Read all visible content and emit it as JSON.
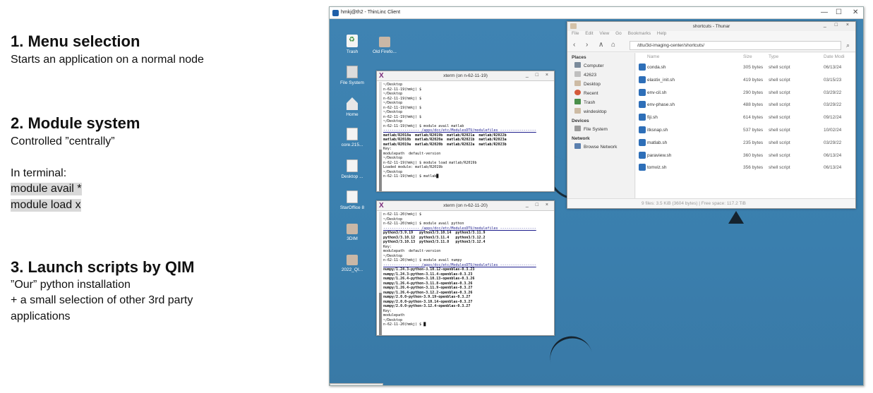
{
  "slide": {
    "s1_title": "1. Menu selection",
    "s1_line1": "Starts an application on a normal node",
    "s2_title": "2. Module system",
    "s2_line1": "Controlled ”centrally”",
    "s2_line2": "In terminal:",
    "s2_cmd1": "module avail *",
    "s2_cmd2": "module load x",
    "s3_title": "3. Launch scripts by QIM",
    "s3_line1": "”Our” python installation",
    "s3_line2": "+ a small selection of other 3rd party",
    "s3_line3": "applications"
  },
  "window": {
    "title": "hmkj@th2 - ThinLinc Client",
    "ctrl_min": "—",
    "ctrl_max": "☐",
    "ctrl_close": "✕"
  },
  "desktop_icons": [
    {
      "label": "Trash",
      "icon": "trash-icon"
    },
    {
      "label": "Old Firefo...",
      "icon": "folder-icon"
    },
    {
      "label": "File System",
      "icon": "filesystem-icon"
    },
    {
      "label": "Home",
      "icon": "home-icon"
    },
    {
      "label": "core.215...",
      "icon": "file-icon"
    },
    {
      "label": "Desktop ...",
      "icon": "file-icon"
    },
    {
      "label": "StarOffice 8",
      "icon": "file-icon"
    },
    {
      "label": "3DIM",
      "icon": "folder-icon"
    },
    {
      "label": "2022_QI...",
      "icon": "folder-icon"
    }
  ],
  "xterm1": {
    "title": "xterm (on n-62-11-19)",
    "controls": "_ □ ×",
    "lines": [
      "~/Desktop",
      "n-62-11-19(hmkj) $",
      "~/Desktop",
      "n-62-11-19(hmkj) $",
      "~/Desktop",
      "n-62-11-19(hmkj) $",
      "~/Desktop",
      "n-62-11-19(hmkj) $",
      "~/Desktop",
      "n-62-11-19(hmkj) $ module avail matlab",
      "----------------- /apps/dcc/etc/ModulesDTU/modulefiles -----------------",
      "matlab/R2018a  matlab/R2019b  matlab/R2021a  matlab/R2022b",
      "matlab/R2018b  matlab/R2020a  matlab/R2021b  matlab/R2023a",
      "matlab/R2019a  matlab/R2020b  matlab/R2022a  matlab/R2023b",
      "",
      "Key:",
      "modulepath  default-version",
      "~/Desktop",
      "n-62-11-19(hmkj) $ module load matlab/R2019b",
      "Loaded module: matlab/R2019b",
      "~/Desktop",
      "n-62-11-19(hmkj) $ matlab█"
    ]
  },
  "xterm2": {
    "title": "xterm (on n-62-11-20)",
    "controls": "_ □ ×",
    "lines": [
      "n-62-11-20(hmkj) $",
      "~/Desktop",
      "n-62-11-20(hmkj) $ module avail python",
      "----------------- /apps/dcc/etc/ModulesDTU/modulefiles -----------------",
      "python3/3.9.19   python3/3.10.14  python3/3.11.9",
      "python3/3.10.12  python3/3.11.4   python3/3.12.2",
      "python3/3.10.13  python3/3.11.8   python3/3.12.4",
      "",
      "Key:",
      "modulepath  default-version",
      "~/Desktop",
      "n-62-11-20(hmkj) $ module avail numpy",
      "----------------- /apps/dcc/etc/ModulesDTU/modulefiles -----------------",
      "numpy/1.24.3-python-3.10.12-openblas-0.3.23",
      "numpy/1.24.3-python-3.11.4-openblas-0.3.23",
      "numpy/1.26.4-python-3.10.13-openblas-0.3.26",
      "numpy/1.26.4-python-3.11.8-openblas-0.3.26",
      "numpy/1.26.4-python-3.11.9-openblas-0.3.27",
      "numpy/1.26.4-python-3.12.2-openblas-0.3.26",
      "numpy/2.0.0-python-3.9.19-openblas-0.3.27",
      "numpy/2.0.0-python-3.10.14-openblas-0.3.27",
      "numpy/2.0.0-python-3.12.4-openblas-0.3.27",
      "",
      "Key:",
      "modulepath",
      "~/Desktop",
      "n-62-11-20(hmkj) $ █"
    ]
  },
  "thunar": {
    "title": "shortcuts - Thunar",
    "controls": "_ □ ×",
    "menu": [
      "File",
      "Edit",
      "View",
      "Go",
      "Bookmarks",
      "Help"
    ],
    "location": "/dtu/3d-imaging-center/shortcuts/",
    "nav_back": "‹",
    "nav_forward": "›",
    "nav_up": "∧",
    "nav_home": "⌂",
    "search_glyph": "⌕",
    "sidebar": {
      "places_label": "Places",
      "places": [
        "Computer",
        "42623",
        "Desktop",
        "Recent",
        "Trash",
        "windesktop"
      ],
      "devices_label": "Devices",
      "devices": [
        "File System"
      ],
      "network_label": "Network",
      "network": [
        "Browse Network"
      ]
    },
    "columns": {
      "name": "Name",
      "size": "Size",
      "type": "Type",
      "date": "Date Modi"
    },
    "files": [
      {
        "name": "conda.sh",
        "size": "305 bytes",
        "type": "shell script",
        "date": "06/13/24"
      },
      {
        "name": "elastix_init.sh",
        "size": "419 bytes",
        "type": "shell script",
        "date": "03/15/23"
      },
      {
        "name": "env-cil.sh",
        "size": "290 bytes",
        "type": "shell script",
        "date": "03/29/22"
      },
      {
        "name": "env-phase.sh",
        "size": "488 bytes",
        "type": "shell script",
        "date": "03/29/22"
      },
      {
        "name": "fiji.sh",
        "size": "614 bytes",
        "type": "shell script",
        "date": "09/12/24"
      },
      {
        "name": "itksnap.sh",
        "size": "537 bytes",
        "type": "shell script",
        "date": "10/02/24"
      },
      {
        "name": "matlab.sh",
        "size": "235 bytes",
        "type": "shell script",
        "date": "03/29/22"
      },
      {
        "name": "paraview.sh",
        "size": "360 bytes",
        "type": "shell script",
        "date": "06/13/24"
      },
      {
        "name": "tomviz.sh",
        "size": "356 bytes",
        "type": "shell script",
        "date": "06/13/24"
      }
    ],
    "status": "9 files: 3.5 KiB (3604 bytes)  |  Free space: 117.2 TiB"
  }
}
